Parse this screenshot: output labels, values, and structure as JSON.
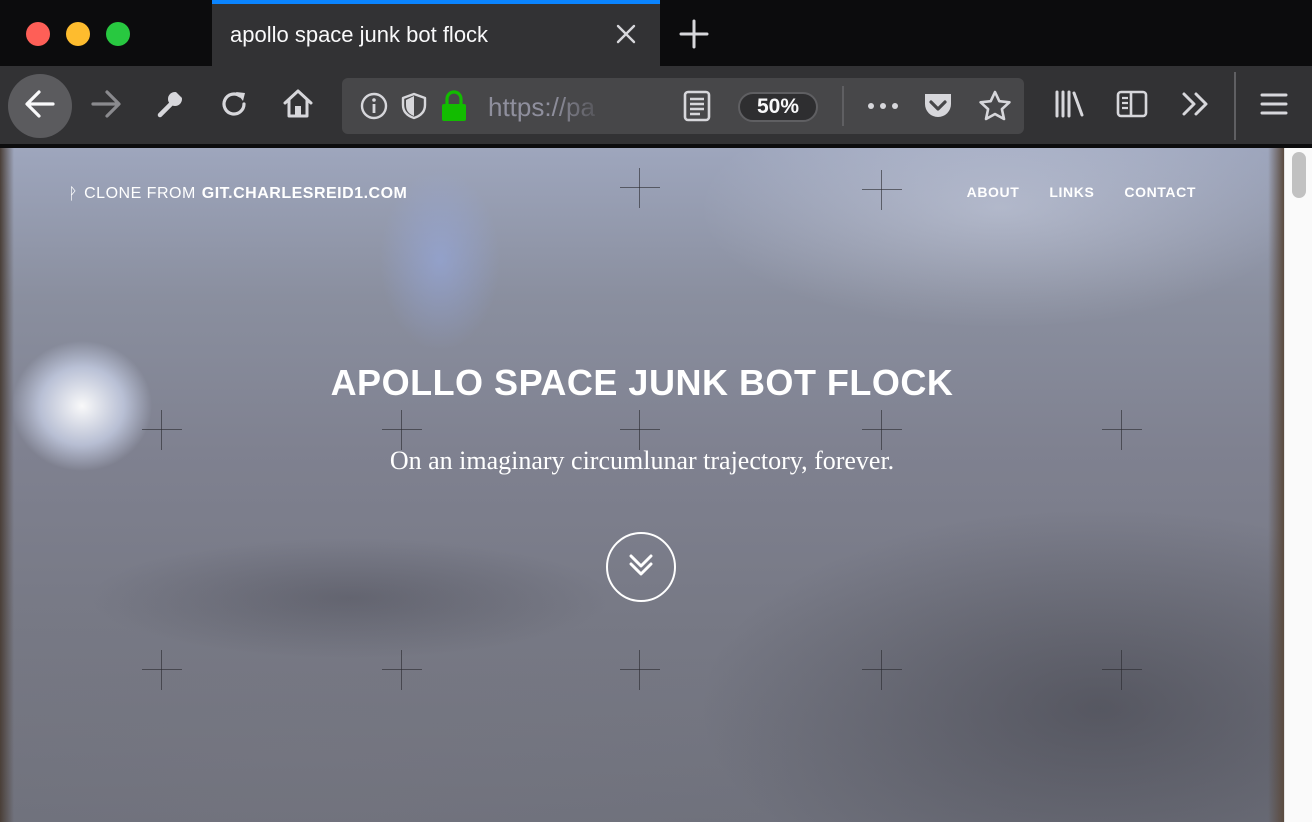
{
  "window": {
    "controls": [
      "close",
      "minimize",
      "zoom"
    ]
  },
  "tab": {
    "title": "apollo space junk bot flock"
  },
  "toolbar": {
    "icons": [
      "back-arrow-icon",
      "forward-arrow-icon",
      "wrench-icon",
      "reload-icon",
      "home-icon",
      "info-icon",
      "shield-icon",
      "lock-icon",
      "reader-view-icon",
      "more-icon",
      "pocket-icon",
      "bookmark-star-icon",
      "library-icon",
      "sidebar-icon",
      "overflow-chevron-icon",
      "hamburger-menu-icon"
    ]
  },
  "urlbar": {
    "url": "https://pa",
    "zoom": "50%"
  },
  "page": {
    "brand_prefix": "CLONE FROM",
    "brand_domain": "GIT.CHARLESREID1.COM",
    "nav": [
      "ABOUT",
      "LINKS",
      "CONTACT"
    ],
    "title": "APOLLO SPACE JUNK BOT FLOCK",
    "subtitle": "On an imaginary circumlunar trajectory, forever."
  }
}
